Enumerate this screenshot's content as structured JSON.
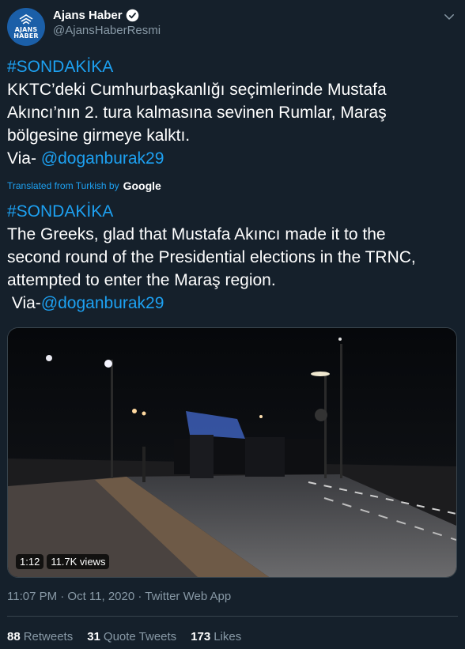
{
  "author": {
    "display_name": "Ajans Haber",
    "handle": "@AjansHaberResmi",
    "avatar_text": "AJANS HABER",
    "verified": true
  },
  "original": {
    "hashtag": "#SONDAKİKA",
    "lines": [
      "KKTC’deki Cumhurbaşkanlığı seçimlerinde Mustafa",
      "Akıncı’nın 2. tura kalmasına sevinen Rumlar, Maraş",
      "bölgesine girmeye kalktı."
    ],
    "via_prefix": "Via- ",
    "mention": "@doganburak29"
  },
  "translation": {
    "label": "Translated from Turkish by",
    "provider": "Google",
    "hashtag": "#SONDAKİKA",
    "lines": [
      "The Greeks, glad that Mustafa Akıncı made it to the",
      "second round of the Presidential elections in the TRNC,",
      "attempted to enter the Maraş region."
    ],
    "via_prefix": " Via-",
    "mention": "@doganburak29"
  },
  "video": {
    "duration": "1:12",
    "views": "11.7K views"
  },
  "meta": {
    "timestamp": "11:07 PM · Oct 11, 2020 · Twitter Web App"
  },
  "stats": {
    "retweets_count": "88",
    "retweets_label": "Retweets",
    "quotes_count": "31",
    "quotes_label": "Quote Tweets",
    "likes_count": "173",
    "likes_label": "Likes"
  },
  "colors": {
    "background": "#15202b",
    "accent": "#1da1f2",
    "secondary_text": "#8899a6",
    "divider": "#38444d"
  }
}
